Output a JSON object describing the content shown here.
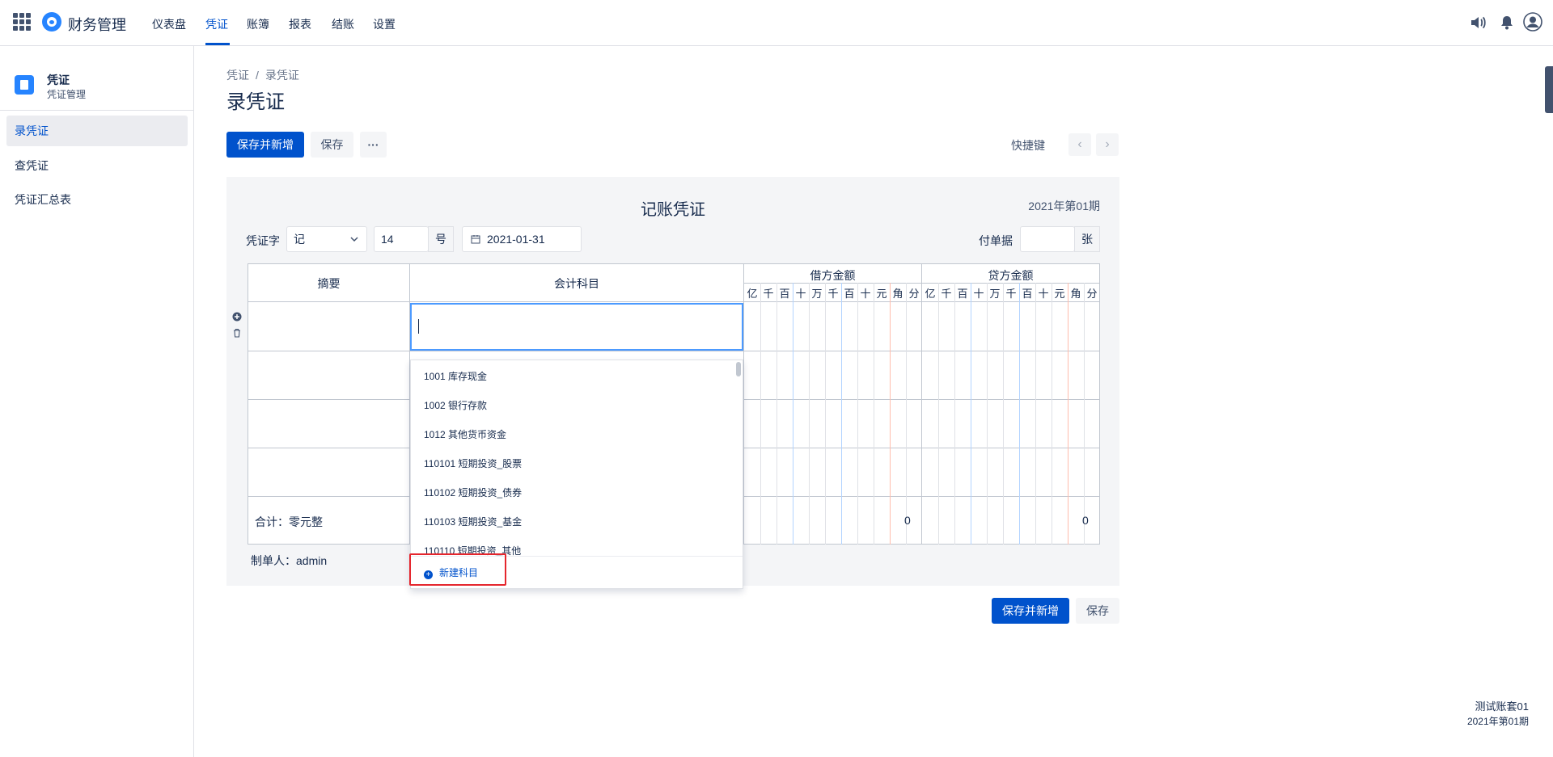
{
  "app": {
    "title": "财务管理"
  },
  "nav": {
    "items": [
      {
        "label": "仪表盘"
      },
      {
        "label": "凭证"
      },
      {
        "label": "账簿"
      },
      {
        "label": "报表"
      },
      {
        "label": "结账"
      },
      {
        "label": "设置"
      }
    ],
    "active": "凭证"
  },
  "sidebar": {
    "title": "凭证",
    "subtitle": "凭证管理",
    "items": [
      {
        "label": "录凭证"
      },
      {
        "label": "查凭证"
      },
      {
        "label": "凭证汇总表"
      }
    ]
  },
  "breadcrumb": {
    "root": "凭证",
    "sep": "/",
    "current": "录凭证"
  },
  "page": {
    "title": "录凭证"
  },
  "toolbar": {
    "save_new": "保存并新增",
    "save": "保存",
    "more": "···",
    "shortcut": "快捷键",
    "prev": "‹",
    "next": "›"
  },
  "voucher": {
    "title": "记账凭证",
    "period": "2021年第01期",
    "word_label": "凭证字",
    "word_value": "记",
    "number_value": "14",
    "number_suffix": "号",
    "date_value": "2021-01-31",
    "attach_label": "付单据",
    "attach_value": "",
    "attach_suffix": "张"
  },
  "grid": {
    "col_summary": "摘要",
    "col_account": "会计科目",
    "col_debit": "借方金额",
    "col_credit": "贷方金额",
    "digits": [
      "亿",
      "千",
      "百",
      "十",
      "万",
      "千",
      "百",
      "十",
      "元",
      "角",
      "分"
    ],
    "total_label": "合计：零元整",
    "debit_total": "0",
    "credit_total": "0"
  },
  "dropdown": {
    "items": [
      {
        "label": "1001 库存现金"
      },
      {
        "label": "1002 银行存款"
      },
      {
        "label": "1012 其他货币资金"
      },
      {
        "label": "110101 短期投资_股票"
      },
      {
        "label": "110102 短期投资_债券"
      },
      {
        "label": "110103 短期投资_基金"
      },
      {
        "label": "110110 短期投资_其他"
      }
    ],
    "new_label": "新建科目"
  },
  "maker": "制单人：admin",
  "bottom": {
    "save_new": "保存并新增",
    "save": "保存"
  },
  "footer": {
    "account_set": "测试账套01",
    "period": "2021年第01期"
  },
  "colors": {
    "primary": "#0052cc",
    "highlight": "#e5262d",
    "active_border": "#4c9aff"
  }
}
